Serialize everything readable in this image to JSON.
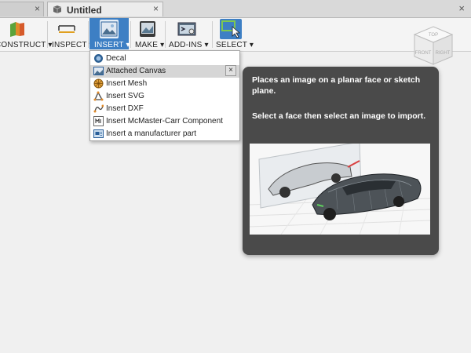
{
  "tabs": [
    {
      "label": "",
      "close": "×"
    },
    {
      "label": "Untitled",
      "close": "×"
    }
  ],
  "window": {
    "close": "×"
  },
  "toolbar": {
    "groups": [
      {
        "label": "CONSTRUCT ▾",
        "icon": "construct-icon"
      },
      {
        "label": "INSPECT ▾",
        "icon": "inspect-icon"
      },
      {
        "label": "INSERT ▾",
        "icon": "insert-image-icon",
        "active": true
      },
      {
        "label": "MAKE ▾",
        "icon": "make-icon"
      },
      {
        "label": "ADD-INS ▾",
        "icon": "add-ins-icon"
      },
      {
        "label": "SELECT ▾",
        "icon": "select-icon"
      }
    ]
  },
  "insert_menu": {
    "items": [
      {
        "label": "Decal",
        "icon": "decal-icon"
      },
      {
        "label": "Attached Canvas",
        "icon": "attached-canvas-icon",
        "highlighted": true
      },
      {
        "label": "Insert Mesh",
        "icon": "mesh-icon"
      },
      {
        "label": "Insert SVG",
        "icon": "svg-icon"
      },
      {
        "label": "Insert DXF",
        "icon": "dxf-icon"
      },
      {
        "label": "Insert McMaster-Carr Component",
        "icon": "mcmaster-icon"
      },
      {
        "label": "Insert a manufacturer part",
        "icon": "manufacturer-part-icon"
      }
    ],
    "pin_label": "×"
  },
  "tooltip": {
    "line1": "Places an image on a planar face or sketch plane.",
    "line2": "Select a face then select an image to import."
  },
  "viewcube": {
    "top": "TOP",
    "front": "FRONT",
    "right": "RIGHT"
  },
  "colors": {
    "accent": "#3d7fc4",
    "tooltip_bg": "#4a4a4a",
    "menu_highlight": "#d6d6d6"
  }
}
